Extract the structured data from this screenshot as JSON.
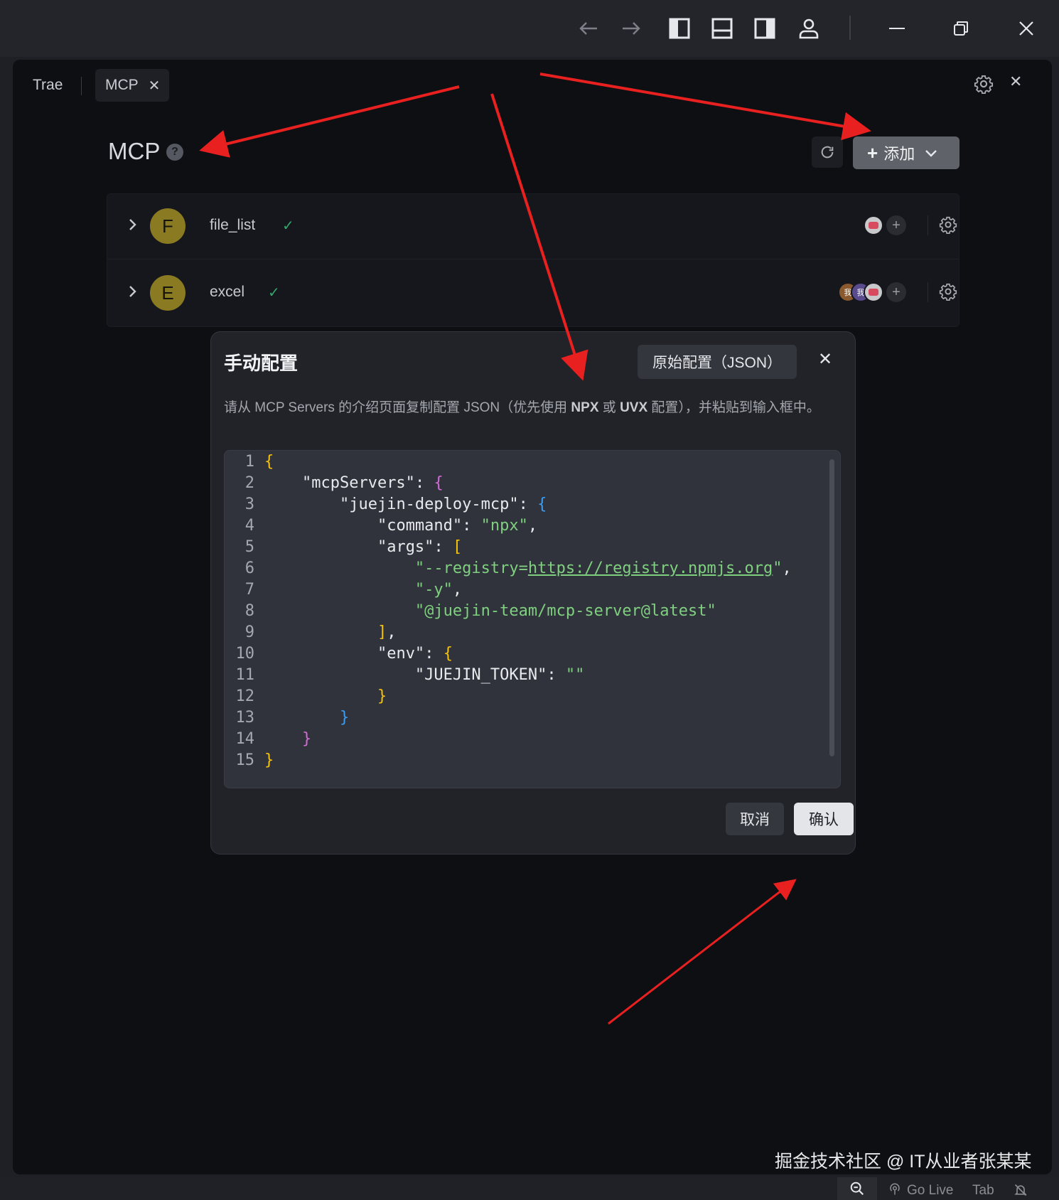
{
  "titlebar": {
    "icons": [
      "back-arrow-icon",
      "forward-arrow-icon",
      "toggle-left-panel-icon",
      "toggle-bottom-panel-icon",
      "toggle-right-panel-icon",
      "account-icon",
      "minimize-icon",
      "restore-icon",
      "close-icon"
    ]
  },
  "tabs": [
    {
      "label": "Trae",
      "active": false
    },
    {
      "label": "MCP",
      "active": true
    }
  ],
  "mcp": {
    "title": "MCP",
    "help": "?",
    "add_label": "添加"
  },
  "servers": [
    {
      "initial": "F",
      "name": "file_list",
      "status": "✓",
      "agents": [
        "agent"
      ]
    },
    {
      "initial": "E",
      "name": "excel",
      "status": "✓",
      "agents": [
        "我",
        "我",
        "agent"
      ]
    }
  ],
  "modal": {
    "title": "手动配置",
    "raw_button": "原始配置（JSON）",
    "close": "✕",
    "desc_part1": "请从 MCP Servers 的介绍页面复制配置 JSON（优先使用 ",
    "desc_npx": "NPX",
    "desc_or": " 或 ",
    "desc_uvx": "UVX",
    "desc_part2": " 配置），并粘贴到输入框中。",
    "cancel": "取消",
    "confirm": "确认"
  },
  "editor": {
    "line_numbers": [
      "1",
      "2",
      "3",
      "4",
      "5",
      "6",
      "7",
      "8",
      "9",
      "10",
      "11",
      "12",
      "13",
      "14",
      "15"
    ],
    "json": {
      "mcpServers": {
        "juejin-deploy-mcp": {
          "command": "npx",
          "args": [
            "--registry=https://registry.npmjs.org",
            "-y",
            "@juejin-team/mcp-server@latest"
          ],
          "env": {
            "JUEJIN_TOKEN": ""
          }
        }
      }
    },
    "tokens": {
      "k_mcpServers": "\"mcpServers\"",
      "k_server": "\"juejin-deploy-mcp\"",
      "k_command": "\"command\"",
      "v_command": "\"npx\"",
      "k_args": "\"args\"",
      "a1_prefix": "\"--registry=",
      "a1_url": "https://registry.npmjs.org",
      "a1_suffix": "\"",
      "a2": "\"-y\"",
      "a3": "\"@juejin-team/mcp-server@latest\"",
      "k_env": "\"env\"",
      "k_token": "\"JUEJIN_TOKEN\"",
      "v_token": "\"\""
    }
  },
  "watermark": "掘金技术社区 @ IT从业者张某某",
  "statusbar": {
    "go_live": "Go Live",
    "tab": "Tab"
  },
  "colors": {
    "annotation_arrow": "#e8201f",
    "accent_yellow": "#f4c20d",
    "check_green": "#2fa96a"
  }
}
